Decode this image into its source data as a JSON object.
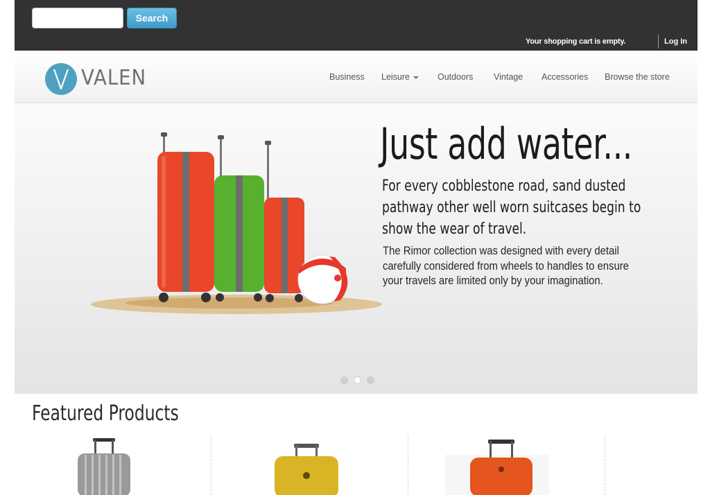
{
  "topbar": {
    "search_placeholder": "",
    "search_button": "Search",
    "cart_status": "Your shopping cart is empty.",
    "login": "Log In"
  },
  "header": {
    "logo_text": "VALEN",
    "nav": [
      {
        "label": "Business"
      },
      {
        "label": "Leisure",
        "has_dropdown": true
      },
      {
        "label": "Outdoors"
      },
      {
        "label": "Vintage"
      },
      {
        "label": "Accessories"
      },
      {
        "label": "Browse the store"
      }
    ]
  },
  "hero": {
    "title": "Just add water...",
    "subtitle": "For every cobblestone road, sand dusted pathway other well worn suitcases begin to show the wear of travel.",
    "body": "The Rimor collection was designed with every detail carefully considered from wheels to handles to ensure your travels are limited only by your imagination.",
    "slide_count": 3,
    "active_slide": 2
  },
  "featured": {
    "title": "Featured Products",
    "products": [
      {
        "icon": "silver-suitcase-icon",
        "color": "#9a9a9a"
      },
      {
        "icon": "yellow-suitcase-icon",
        "color": "#d9b526"
      },
      {
        "icon": "orange-suitcase-icon",
        "color": "#e4551f"
      }
    ]
  },
  "colors": {
    "topbar": "#323232",
    "accent": "#4ea2c1",
    "search_button": "#4aa5d3"
  }
}
